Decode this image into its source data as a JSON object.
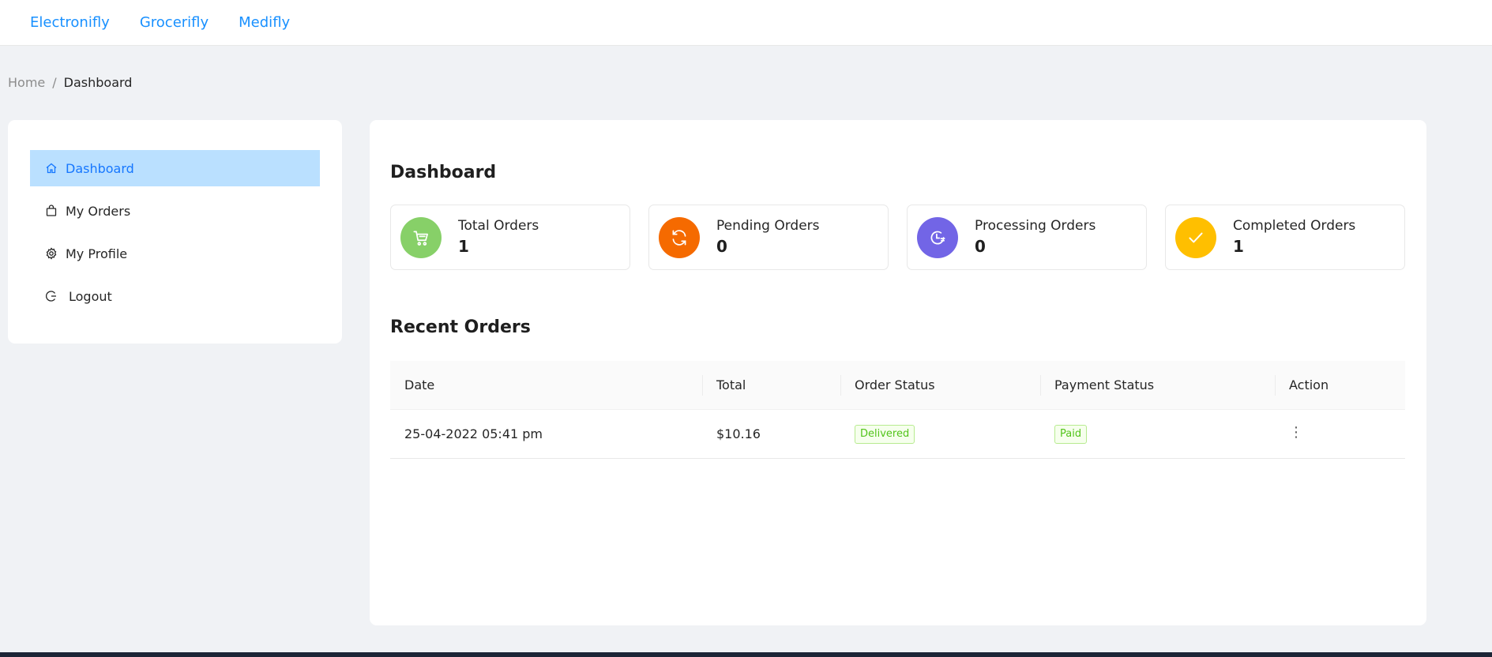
{
  "nav": {
    "links": [
      "Electronifly",
      "Grocerifly",
      "Medifly"
    ]
  },
  "breadcrumb": {
    "home": "Home",
    "separator": "/",
    "current": "Dashboard"
  },
  "sidebar": {
    "items": [
      {
        "label": "Dashboard",
        "icon": "home-icon",
        "active": true
      },
      {
        "label": "My Orders",
        "icon": "shopping-bag-icon"
      },
      {
        "label": "My Profile",
        "icon": "gear-icon"
      },
      {
        "label": "Logout",
        "icon": "logout-icon"
      }
    ]
  },
  "dashboard": {
    "title": "Dashboard",
    "cards": [
      {
        "label": "Total Orders",
        "value": "1",
        "color": "#87d068",
        "icon": "cart-icon"
      },
      {
        "label": "Pending Orders",
        "value": "0",
        "color": "#f56a00",
        "icon": "sync-icon"
      },
      {
        "label": "Processing Orders",
        "value": "0",
        "color": "#7265e6",
        "icon": "clock-icon"
      },
      {
        "label": "Completed Orders",
        "value": "1",
        "color": "#ffbf00",
        "icon": "check-icon"
      }
    ]
  },
  "recent_orders": {
    "title": "Recent Orders",
    "columns": [
      "Date",
      "Total",
      "Order Status",
      "Payment Status",
      "Action"
    ],
    "rows": [
      {
        "date": "25-04-2022 05:41 pm",
        "total": "$10.16",
        "order_status": "Delivered",
        "payment_status": "Paid",
        "action": "⋮"
      }
    ]
  }
}
